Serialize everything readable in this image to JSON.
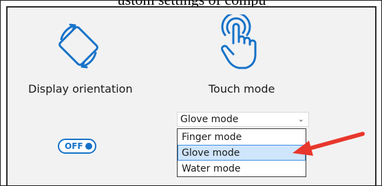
{
  "page": {
    "top_text": "ustom settings of compu"
  },
  "display_orientation": {
    "label": "Display orientation",
    "icon": "rotate-screen-icon",
    "toggle_label": "OFF",
    "toggle_state": "off"
  },
  "touch_mode": {
    "label": "Touch mode",
    "icon": "touch-hand-icon",
    "selected_value": "Glove mode",
    "options": [
      "Finger mode",
      "Glove mode",
      "Water mode"
    ],
    "highlighted_option": "Glove mode"
  },
  "colors": {
    "accent": "#1672c9",
    "annotation_arrow": "#e8372c",
    "panel_background": "#f2f2f2",
    "selected_option_bg": "#cfe5fb"
  }
}
